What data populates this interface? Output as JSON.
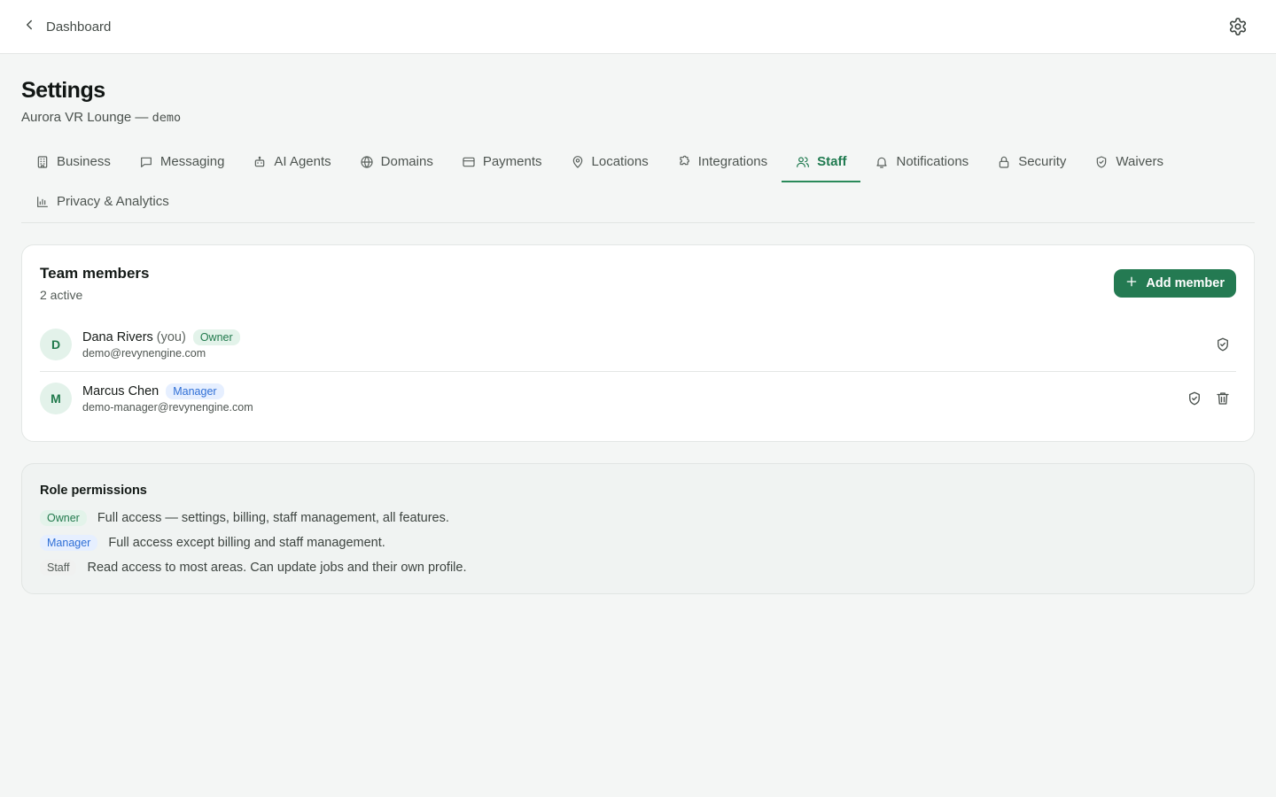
{
  "topbar": {
    "back_label": "Dashboard"
  },
  "page": {
    "title": "Settings",
    "subtitle_prefix": "Aurora VR Lounge — ",
    "subtitle_mono": "demo"
  },
  "tabs": [
    {
      "label": "Business",
      "icon": "building-icon",
      "active": false
    },
    {
      "label": "Messaging",
      "icon": "message-icon",
      "active": false
    },
    {
      "label": "AI Agents",
      "icon": "bot-icon",
      "active": false
    },
    {
      "label": "Domains",
      "icon": "globe-icon",
      "active": false
    },
    {
      "label": "Payments",
      "icon": "credit-card-icon",
      "active": false
    },
    {
      "label": "Locations",
      "icon": "map-pin-icon",
      "active": false
    },
    {
      "label": "Integrations",
      "icon": "puzzle-icon",
      "active": false
    },
    {
      "label": "Staff",
      "icon": "users-icon",
      "active": true
    },
    {
      "label": "Notifications",
      "icon": "bell-icon",
      "active": false
    },
    {
      "label": "Security",
      "icon": "lock-icon",
      "active": false
    },
    {
      "label": "Waivers",
      "icon": "shield-check-icon",
      "active": false
    },
    {
      "label": "Privacy & Analytics",
      "icon": "bar-chart-icon",
      "active": false
    }
  ],
  "team": {
    "title": "Team members",
    "subtitle": "2 active",
    "add_label": "Add member",
    "members": [
      {
        "initial": "D",
        "name": "Dana Rivers",
        "you": "(you)",
        "role": "Owner",
        "email": "demo@revynengine.com"
      },
      {
        "initial": "M",
        "name": "Marcus Chen",
        "you": "",
        "role": "Manager",
        "email": "demo-manager@revynengine.com"
      }
    ]
  },
  "permissions": {
    "title": "Role permissions",
    "rows": [
      {
        "role": "Owner",
        "text": "Full access — settings, billing, staff management, all features."
      },
      {
        "role": "Manager",
        "text": "Full access except billing and staff management."
      },
      {
        "role": "Staff",
        "text": "Read access to most areas. Can update jobs and their own profile."
      }
    ]
  },
  "colors": {
    "accent": "#247a52",
    "owner_badge_bg": "#e3f3ea",
    "manager_badge_bg": "#e6efff",
    "page_bg": "#f4f6f5"
  }
}
